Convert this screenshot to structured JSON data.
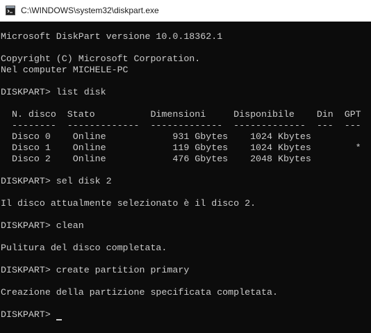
{
  "window": {
    "title": "C:\\WINDOWS\\system32\\diskpart.exe"
  },
  "console": {
    "lines": [
      "Microsoft DiskPart versione 10.0.18362.1",
      "",
      "Copyright (C) Microsoft Corporation.",
      "Nel computer MICHELE-PC",
      "",
      "DISKPART> list disk",
      "",
      "  N. disco  Stato          Dimensioni     Disponibile    Din  GPT",
      "  --------  -------------  -------------  -------------  ---  ---",
      "  Disco 0    Online            931 Gbytes    1024 Kbytes",
      "  Disco 1    Online            119 Gbytes    1024 Kbytes        *",
      "  Disco 2    Online            476 Gbytes    2048 Kbytes",
      "",
      "DISKPART> sel disk 2",
      "",
      "Il disco attualmente selezionato è il disco 2.",
      "",
      "DISKPART> clean",
      "",
      "Pulitura del disco completata.",
      "",
      "DISKPART> create partition primary",
      "",
      "Creazione della partizione specificata completata.",
      "",
      "DISKPART> "
    ]
  }
}
